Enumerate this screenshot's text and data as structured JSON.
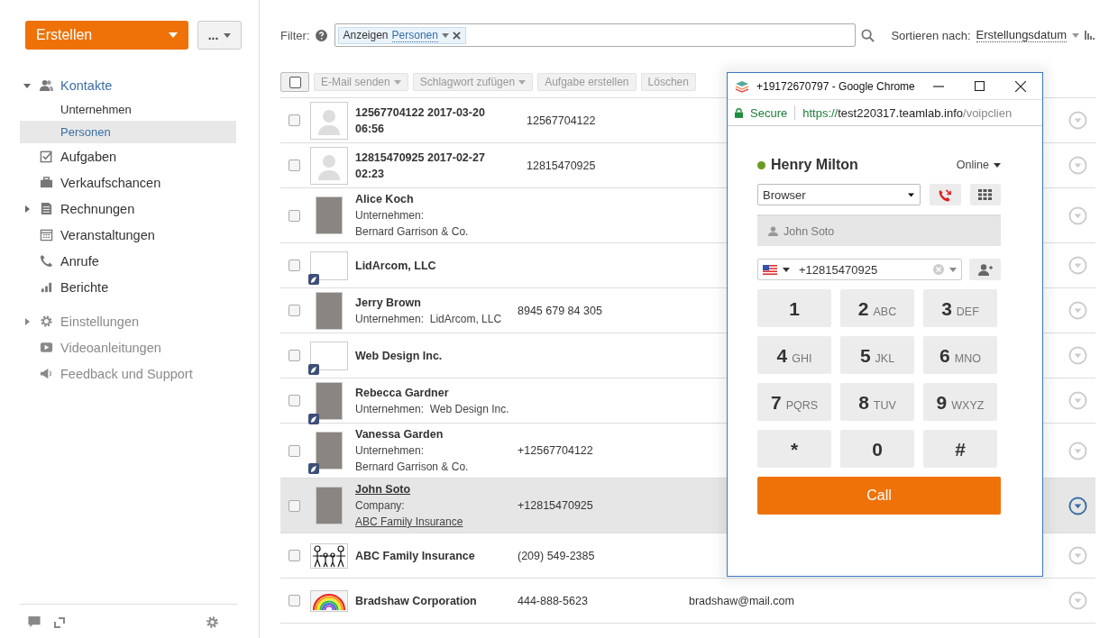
{
  "sidebar": {
    "create_button": "Erstellen",
    "more_button": "...",
    "items": [
      {
        "label": "Kontakte",
        "expanded": true,
        "active": true,
        "children": [
          {
            "label": "Unternehmen",
            "selected": false
          },
          {
            "label": "Personen",
            "selected": true
          }
        ]
      },
      {
        "label": "Aufgaben",
        "active": false
      },
      {
        "label": "Verkaufschancen",
        "active": false
      },
      {
        "label": "Rechnungen",
        "expanded": false,
        "active": false
      },
      {
        "label": "Veranstaltungen",
        "active": false
      },
      {
        "label": "Anrufe",
        "active": false
      },
      {
        "label": "Berichte",
        "active": false
      }
    ],
    "extra_items": [
      {
        "label": "Einstellungen",
        "expanded": false
      },
      {
        "label": "Videoanleitungen"
      },
      {
        "label": "Feedback und Support"
      }
    ]
  },
  "filter": {
    "label": "Filter:",
    "chip_label": "Anzeigen",
    "chip_value": "Personen"
  },
  "sort": {
    "label": "Sortieren nach:",
    "value": "Erstellungsdatum"
  },
  "select_all": {
    "checked": false
  },
  "toolbar": [
    {
      "label": "E-Mail senden",
      "dropdown": true
    },
    {
      "label": "Schlagwort zufügen",
      "dropdown": true
    },
    {
      "label": "Aufgabe erstellen",
      "dropdown": false
    },
    {
      "label": "Löschen",
      "dropdown": false
    }
  ],
  "rows": [
    {
      "kind": "avatar",
      "name": "12567704122 2017-03-20 06:56",
      "phone": "12567704122",
      "selected": false
    },
    {
      "kind": "avatar",
      "name": "12815470925 2017-02-27 02:23",
      "phone": "12815470925",
      "selected": false
    },
    {
      "kind": "photo",
      "name": "Alice Koch",
      "label": "Unternehmen:",
      "company": "Bernard Garrison & Co.",
      "inline": false,
      "selected": false
    },
    {
      "kind": "logo",
      "name": "LidArcom, LLC",
      "badge": true,
      "selected": false
    },
    {
      "kind": "photo",
      "name": "Jerry Brown",
      "label": "Unternehmen:",
      "company": "LidArcom, LLC",
      "inline": true,
      "phone": "8945 679 84 305",
      "selected": false
    },
    {
      "kind": "logo",
      "name": "Web Design Inc.",
      "badge": true,
      "selected": false
    },
    {
      "kind": "photo",
      "name": "Rebecca Gardner",
      "label": "Unternehmen:",
      "company": "Web Design Inc.",
      "inline": true,
      "badge": true,
      "selected": false
    },
    {
      "kind": "photo",
      "name": "Vanessa Garden",
      "label": "Unternehmen:",
      "company": "Bernard Garrison & Co.",
      "inline": false,
      "phone": "+12567704122",
      "badge": true,
      "selected": false
    },
    {
      "kind": "photo",
      "name": "John Soto",
      "label": "Company:",
      "company": "ABC Family Insurance",
      "inline": false,
      "phone": "+12815470925",
      "selected": true
    },
    {
      "kind": "family",
      "name": "ABC Family Insurance",
      "phone": "(209) 549-2385",
      "selected": false
    },
    {
      "kind": "rainbow",
      "name": "Bradshaw Corporation",
      "phone": "444-888-5623",
      "email": "bradshaw@mail.com",
      "selected": false
    }
  ],
  "popup": {
    "title": "+19172670797 - Google Chrome",
    "secure": "Secure",
    "url_scheme": "https://",
    "url_host": "test220317.teamlab.info",
    "url_path": "/voipclien",
    "user": "Henry Milton",
    "status": "Online",
    "device": "Browser",
    "contact": "John Soto",
    "number": "+12815470925",
    "keys": [
      {
        "digit": "1"
      },
      {
        "digit": "2",
        "letters": "ABC"
      },
      {
        "digit": "3",
        "letters": "DEF"
      },
      {
        "digit": "4",
        "letters": "GHI"
      },
      {
        "digit": "5",
        "letters": "JKL"
      },
      {
        "digit": "6",
        "letters": "MNO"
      },
      {
        "digit": "7",
        "letters": "PQRS"
      },
      {
        "digit": "8",
        "letters": "TUV"
      },
      {
        "digit": "9",
        "letters": "WXYZ"
      },
      {
        "digit": "*"
      },
      {
        "digit": "0"
      },
      {
        "digit": "#"
      }
    ],
    "call_button": "Call"
  }
}
